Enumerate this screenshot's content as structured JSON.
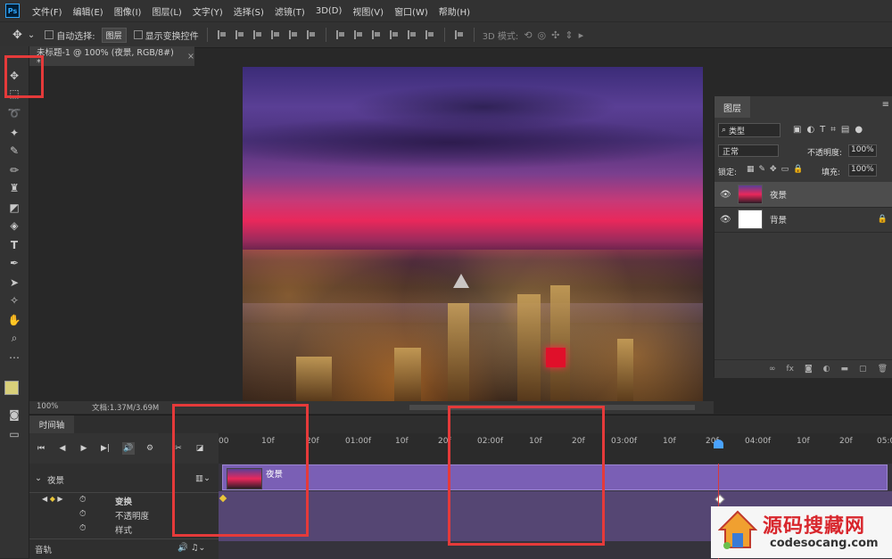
{
  "app": {
    "logo": "Ps"
  },
  "menu": [
    "文件(F)",
    "编辑(E)",
    "图像(I)",
    "图层(L)",
    "文字(Y)",
    "选择(S)",
    "滤镜(T)",
    "3D(D)",
    "视图(V)",
    "窗口(W)",
    "帮助(H)"
  ],
  "options": {
    "auto_select_label": "自动选择:",
    "auto_select_value": "图层",
    "show_transform_label": "显示变换控件",
    "mode_3d_label": "3D 模式:"
  },
  "document": {
    "tab_title": "未标题-1 @ 100% (夜景, RGB/8#) *",
    "zoom": "100%",
    "doc_info": "文档:1.37M/3.69M"
  },
  "layers_panel": {
    "tab": "图层",
    "filter_kind": "类型",
    "blend_mode": "正常",
    "opacity_label": "不透明度:",
    "opacity_value": "100%",
    "lock_label": "锁定:",
    "fill_label": "填充:",
    "fill_value": "100%",
    "layers": [
      {
        "name": "夜景",
        "selected": true
      },
      {
        "name": "背景",
        "locked": true
      }
    ]
  },
  "timeline": {
    "tab": "时间轴",
    "ruler_ticks": [
      "00",
      "10f",
      "20f",
      "01:00f",
      "10f",
      "20f",
      "02:00f",
      "10f",
      "20f",
      "03:00f",
      "10f",
      "20f",
      "04:00f",
      "10f",
      "20f",
      "05:0"
    ],
    "layer_track": "夜景",
    "clip_name": "夜景",
    "properties": [
      "变换",
      "不透明度",
      "样式"
    ],
    "audio_track": "音轨"
  },
  "watermark": {
    "title": "源码搜藏网",
    "url": "codesocang.com"
  },
  "colors": {
    "annotation_red": "#e53a3a",
    "clip_purple": "#7a5fb5",
    "playhead_blue": "#4aa3ff",
    "foreground_swatch": "#d8cf7a"
  }
}
